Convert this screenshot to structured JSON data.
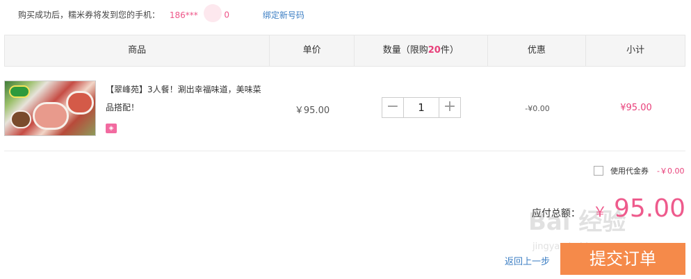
{
  "notice": {
    "text": "购买成功后，糯米券将发到您的手机：",
    "phone": "186***",
    "phone_end": "0",
    "bind_link": "绑定新号码"
  },
  "table": {
    "headers": {
      "product": "商品",
      "unit_price": "单价",
      "quantity_prefix": "数量（限购",
      "quantity_limit": "20",
      "quantity_suffix": "件）",
      "discount": "优惠",
      "subtotal": "小计"
    },
    "item": {
      "title": "【翠峰苑】3人餐！涮出幸福味道，美味菜品搭配！",
      "unit_price": "￥95.00",
      "quantity": "1",
      "minus": "−",
      "plus": "+",
      "discount": "-¥0.00",
      "subtotal": "¥95.00"
    }
  },
  "voucher": {
    "label": "使用代金券",
    "amount": "-￥0.00"
  },
  "total": {
    "label": "应付总额：",
    "currency": "￥",
    "amount": "95.00"
  },
  "actions": {
    "back": "返回上一步",
    "submit": "提交订单"
  },
  "watermark": {
    "text": "Bai 经验",
    "sub": "jingyan.baidu.com"
  },
  "colors": {
    "accent": "#e8407a",
    "submit": "#f58a4a",
    "link": "#3d7fc4"
  }
}
